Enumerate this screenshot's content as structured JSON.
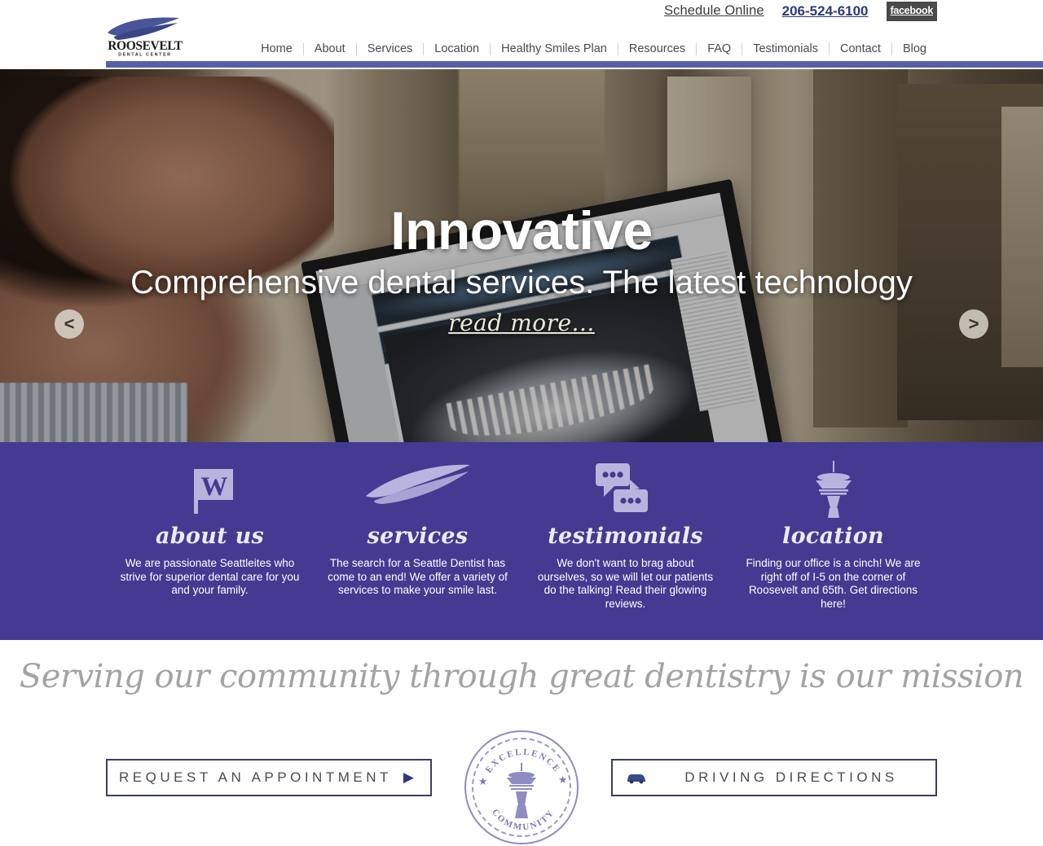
{
  "brand": {
    "name": "ROOSEVELT",
    "tagline": "DENTAL CENTER",
    "accent_color": "#5560a8",
    "band_color": "#453a91"
  },
  "header": {
    "utility": {
      "schedule_label": "Schedule Online",
      "phone": "206-524-6100",
      "facebook_label": "facebook"
    },
    "nav": [
      {
        "label": "Home"
      },
      {
        "label": "About"
      },
      {
        "label": "Services"
      },
      {
        "label": "Location"
      },
      {
        "label": "Healthy Smiles Plan"
      },
      {
        "label": "Resources"
      },
      {
        "label": "FAQ"
      },
      {
        "label": "Testimonials"
      },
      {
        "label": "Contact"
      },
      {
        "label": "Blog"
      }
    ]
  },
  "hero": {
    "title": "Innovative",
    "subtitle": "Comprehensive dental services. The latest technology",
    "read_more": "read more...",
    "prev_arrow": "<",
    "next_arrow": ">"
  },
  "features": [
    {
      "icon": "flag-w-icon",
      "title": "about us",
      "text": "We are passionate Seattleites who strive for superior dental care for you and your family."
    },
    {
      "icon": "swoosh-icon",
      "title": "services",
      "text": "The search for a Seattle Dentist has come to an end! We offer a variety of services to make your smile last."
    },
    {
      "icon": "speech-bubbles-icon",
      "title": "testimonials",
      "text": "We don't want to brag about ourselves, so we will let our patients do the talking! Read their glowing reviews."
    },
    {
      "icon": "space-needle-icon",
      "title": "location",
      "text": "Finding our office is a cinch! We are right off of I-5 on the corner of Roosevelt and 65th. Get directions here!"
    }
  ],
  "mission": {
    "statement": "Serving our community through great dentistry is our mission"
  },
  "seal": {
    "top_text": "★ EXCELLENCE ★",
    "bottom_text": "COMMUNITY"
  },
  "cta": {
    "appointment_label": "REQUEST AN APPOINTMENT",
    "appointment_arrow": "▶",
    "directions_label": "DRIVING DIRECTIONS",
    "directions_icon": "car-icon"
  }
}
